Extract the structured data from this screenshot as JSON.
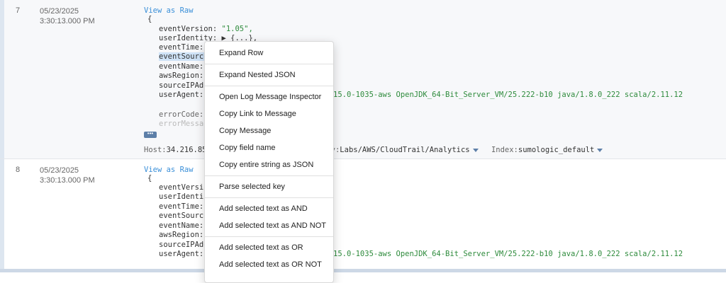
{
  "rows": [
    {
      "number": "7",
      "date": "05/23/2025",
      "time": "3:30:13.000 PM",
      "view_raw": "View as Raw",
      "open_brace": "{",
      "fields": {
        "eventVersion_key": "eventVersion:",
        "eventVersion_val": "\"1.05\",",
        "userIdentity_key": "userIdentity:",
        "userIdentity_val": "▶ {...},",
        "eventTime_key": "eventTime:",
        "eventSource_key": "eventSource",
        "eventName_key": "eventName:",
        "awsRegion_key": "awsRegion:",
        "sourceIP_key": "sourceIPAdd",
        "userAgent_key": "userAgent:",
        "userAgent_val": "15.0-1035-aws OpenJDK_64-Bit_Server_VM/25.222-b10 java/1.8.0_222 scala/2.11.12",
        "errorCode_key": "errorCode:",
        "errorMessage_key": "errorMessag"
      },
      "more_label": "•••",
      "host_label": "Host:",
      "host_value": "34.216.85.",
      "category_label": "ory:",
      "category_value": "Labs/AWS/CloudTrail/Analytics",
      "index_label": "Index:",
      "index_value": "sumologic_default"
    },
    {
      "number": "8",
      "date": "05/23/2025",
      "time": "3:30:13.000 PM",
      "view_raw": "View as Raw",
      "open_brace": "{",
      "fields": {
        "eventVersion_key": "eventVersio",
        "userIdentity_key": "userIdenti",
        "eventTime_key": "eventTime:",
        "eventSource_key": "eventSource",
        "eventName_key": "eventName:",
        "awsRegion_key": "awsRegion:",
        "sourceIP_key": "sourceIPAdd",
        "userAgent_key": "userAgent:",
        "userAgent_val": "15.0-1035-aws OpenJDK_64-Bit_Server_VM/25.222-b10 java/1.8.0_222 scala/2.11.12"
      }
    }
  ],
  "context_menu": {
    "items": [
      "Expand Row",
      "Expand Nested JSON",
      "Open Log Message Inspector",
      "Copy Link to Message",
      "Copy Message",
      "Copy field name",
      "Copy entire string as JSON",
      "Parse selected key",
      "Add selected text as AND",
      "Add selected text as AND NOT",
      "Add selected text as OR",
      "Add selected text as OR NOT"
    ]
  },
  "top_icons": [
    "zoom-icon",
    "copy-icon",
    "link-icon"
  ]
}
